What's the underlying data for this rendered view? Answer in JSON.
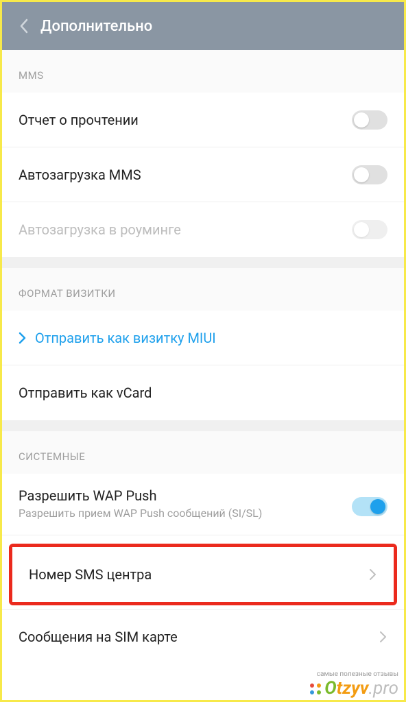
{
  "header": {
    "title": "Дополнительно"
  },
  "sections": {
    "mms": {
      "label": "MMS",
      "read_report": "Отчет о прочтении",
      "auto_download": "Автозагрузка MMS",
      "auto_download_roaming": "Автозагрузка в роуминге"
    },
    "vcard": {
      "label": "ФОРМАТ ВИЗИТКИ",
      "send_miui": "Отправить как визитку MIUI",
      "send_vcard": "Отправить как vCard"
    },
    "system": {
      "label": "СИСТЕМНЫЕ",
      "wap_push_title": "Разрешить WAP Push",
      "wap_push_sub": "Разрешить прием WAP Push сообщений (SI/SL)",
      "sms_center": "Номер SMS центра",
      "sim_messages": "Сообщения на SIM карте"
    }
  },
  "watermark": {
    "sub": "самые полезные отзывы",
    "brand": "Otzyv",
    "suffix": ".pro"
  }
}
